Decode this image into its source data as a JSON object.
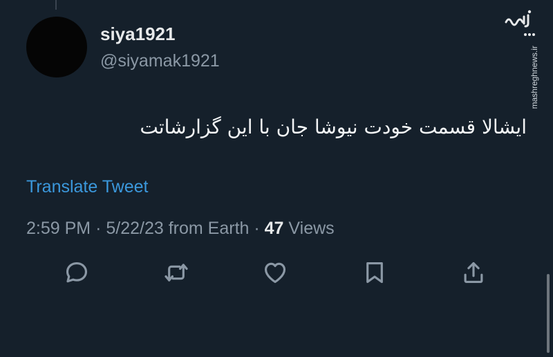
{
  "tweet": {
    "author": {
      "display_name": "siya1921",
      "handle": "@siyamak1921"
    },
    "text": "ایشالا قسمت خودت نیوشا جان با این گزارشاتت",
    "translate_label": "Translate Tweet",
    "meta": {
      "time": "2:59 PM",
      "separator": "·",
      "date": "5/22/23",
      "source": "from Earth",
      "views_count": "47",
      "views_label": "Views"
    },
    "actions": [
      {
        "name": "reply",
        "icon": "reply-icon"
      },
      {
        "name": "retweet",
        "icon": "retweet-icon"
      },
      {
        "name": "like",
        "icon": "heart-icon"
      },
      {
        "name": "bookmark",
        "icon": "bookmark-icon"
      },
      {
        "name": "share",
        "icon": "share-icon"
      }
    ]
  },
  "watermark": {
    "logo_text": "مشرق",
    "url": "mashreghnews.ir"
  },
  "colors": {
    "background": "#15202b",
    "text_primary": "#e7e9ea",
    "text_secondary": "#8b98a5",
    "link": "#3b98dc",
    "icon": "#8b98a5"
  }
}
